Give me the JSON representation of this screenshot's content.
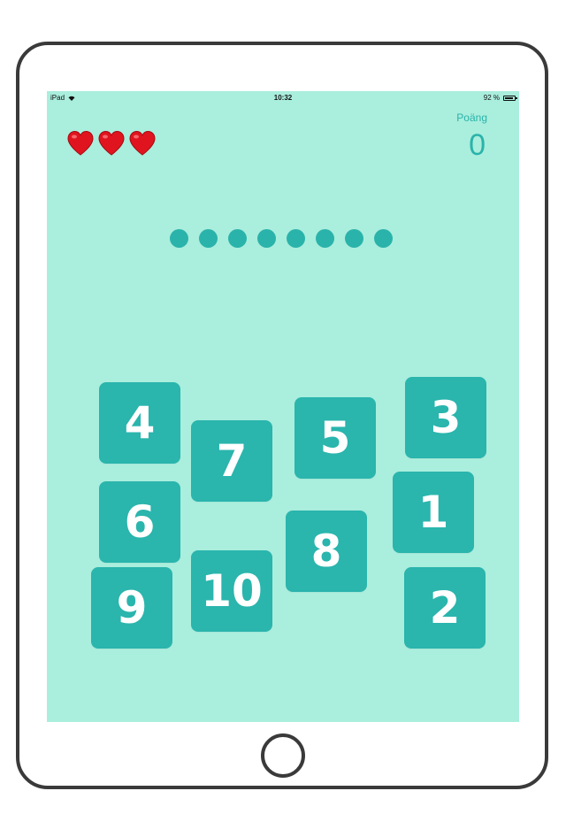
{
  "status_bar": {
    "device": "iPad",
    "time": "10:32",
    "battery": "92 %",
    "battery_level": 0.92
  },
  "lives": {
    "count": 3,
    "icon": "heart-icon",
    "color": "#e0141f"
  },
  "score": {
    "label": "Poäng",
    "value": "0"
  },
  "progress_dots": {
    "count": 8,
    "color": "#2ab3aa"
  },
  "tiles": [
    "4",
    "7",
    "5",
    "3",
    "6",
    "1",
    "8",
    "10",
    "9",
    "2"
  ],
  "colors": {
    "screen_bg": "#aaeedd",
    "tile_bg": "#2ab5ad",
    "accent": "#2ab3aa"
  }
}
